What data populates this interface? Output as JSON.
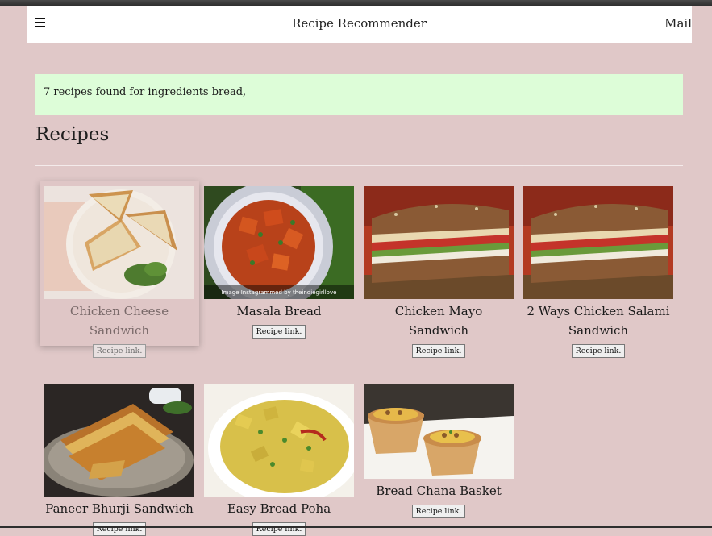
{
  "navbar": {
    "title": "Recipe Recommender",
    "mail": "Mail"
  },
  "alert": {
    "message": "7 recipes found for ingredients bread,"
  },
  "section": {
    "heading": "Recipes"
  },
  "recipes": [
    {
      "title": "Chicken Cheese Sandwich",
      "button": "Recipe link."
    },
    {
      "title": "Masala Bread",
      "button": "Recipe link.",
      "image_caption": "Image Instagrammed by theindiegirllove"
    },
    {
      "title": "Chicken Mayo Sandwich",
      "button": "Recipe link."
    },
    {
      "title": "2 Ways Chicken Salami Sandwich",
      "button": "Recipe link."
    },
    {
      "title": "Paneer Bhurji Sandwich",
      "button": "Recipe link."
    },
    {
      "title": "Easy Bread Poha",
      "button": "Recipe link."
    },
    {
      "title": "Bread Chana Basket",
      "button": "Recipe link."
    }
  ],
  "colors": {
    "page_background": "#e0c8c8",
    "navbar_background": "#ffffff",
    "alert_background": "#ddfdd8"
  },
  "icons": {
    "menu": "hamburger-menu-icon"
  }
}
